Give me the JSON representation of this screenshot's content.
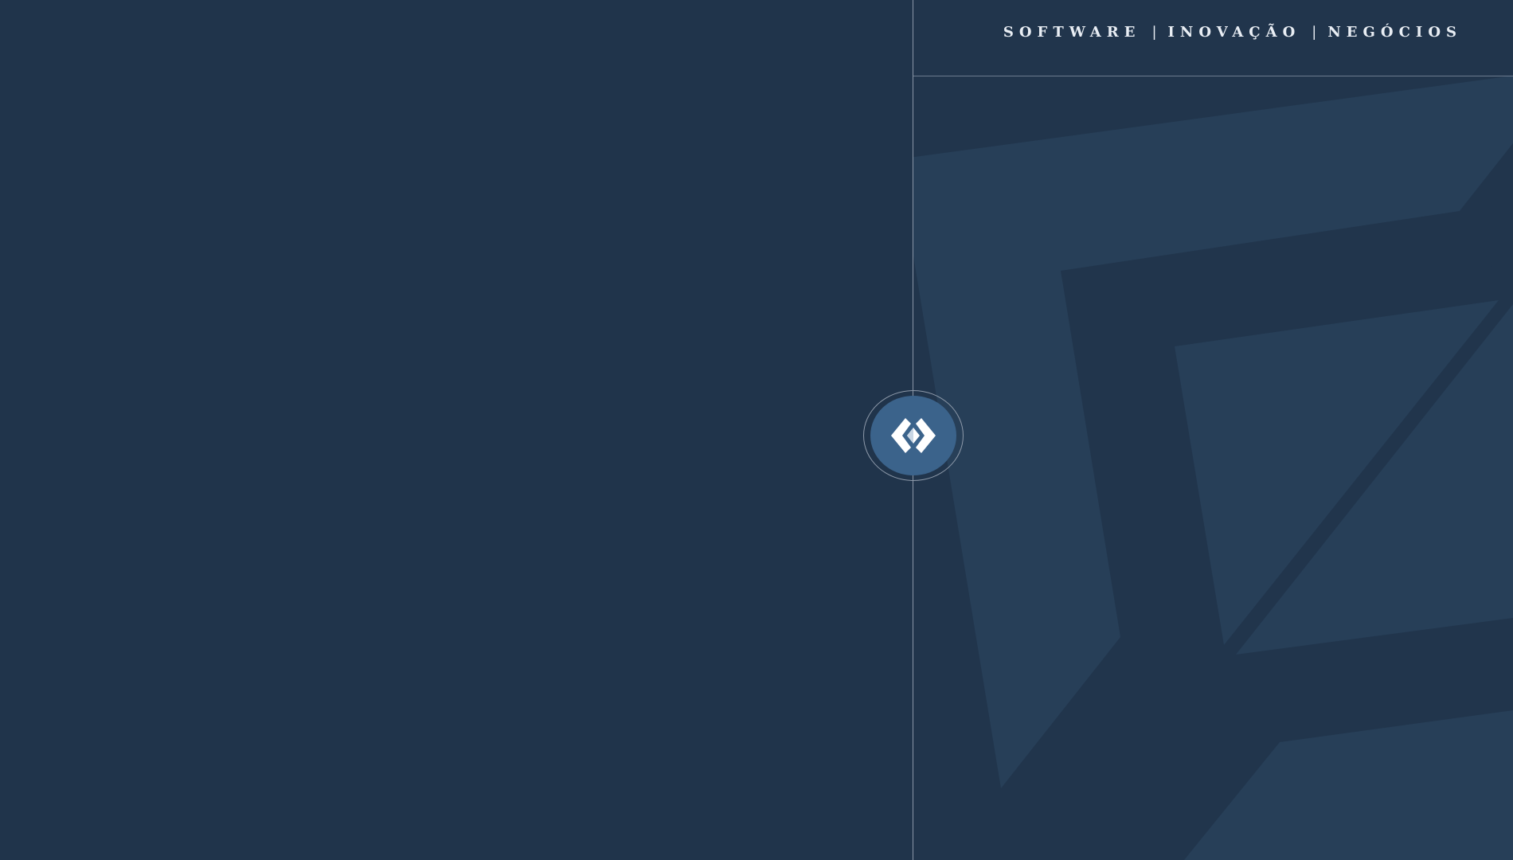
{
  "header": {
    "tagline": {
      "item1": "SOFTWARE",
      "item2": "INOVAÇÃO",
      "item3": "NEGÓCIOS",
      "separator": "|"
    }
  },
  "logo": {
    "icon": "code-brackets-diamond-icon"
  },
  "colors": {
    "background": "#20344b",
    "pattern_light": "#273f58",
    "divider": "#8a96a6",
    "logo_fill": "#3b638b",
    "text": "#e9eef4"
  }
}
